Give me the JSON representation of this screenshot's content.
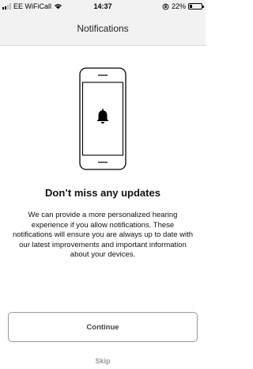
{
  "status_bar": {
    "carrier": "EE WiFiCall",
    "time": "14:37",
    "battery_text": "22%",
    "battery_level": 0.22
  },
  "nav": {
    "title": "Notifications"
  },
  "illustration": {
    "icon": "bell-icon"
  },
  "content": {
    "heading": "Don’t miss any updates",
    "body": "We can provide a more  personalized hearing experience if you allow notifications. These notifications will ensure you are always up to date with our latest improvements and important information about your devices."
  },
  "actions": {
    "continue_label": "Continue",
    "skip_label": "Skip"
  }
}
